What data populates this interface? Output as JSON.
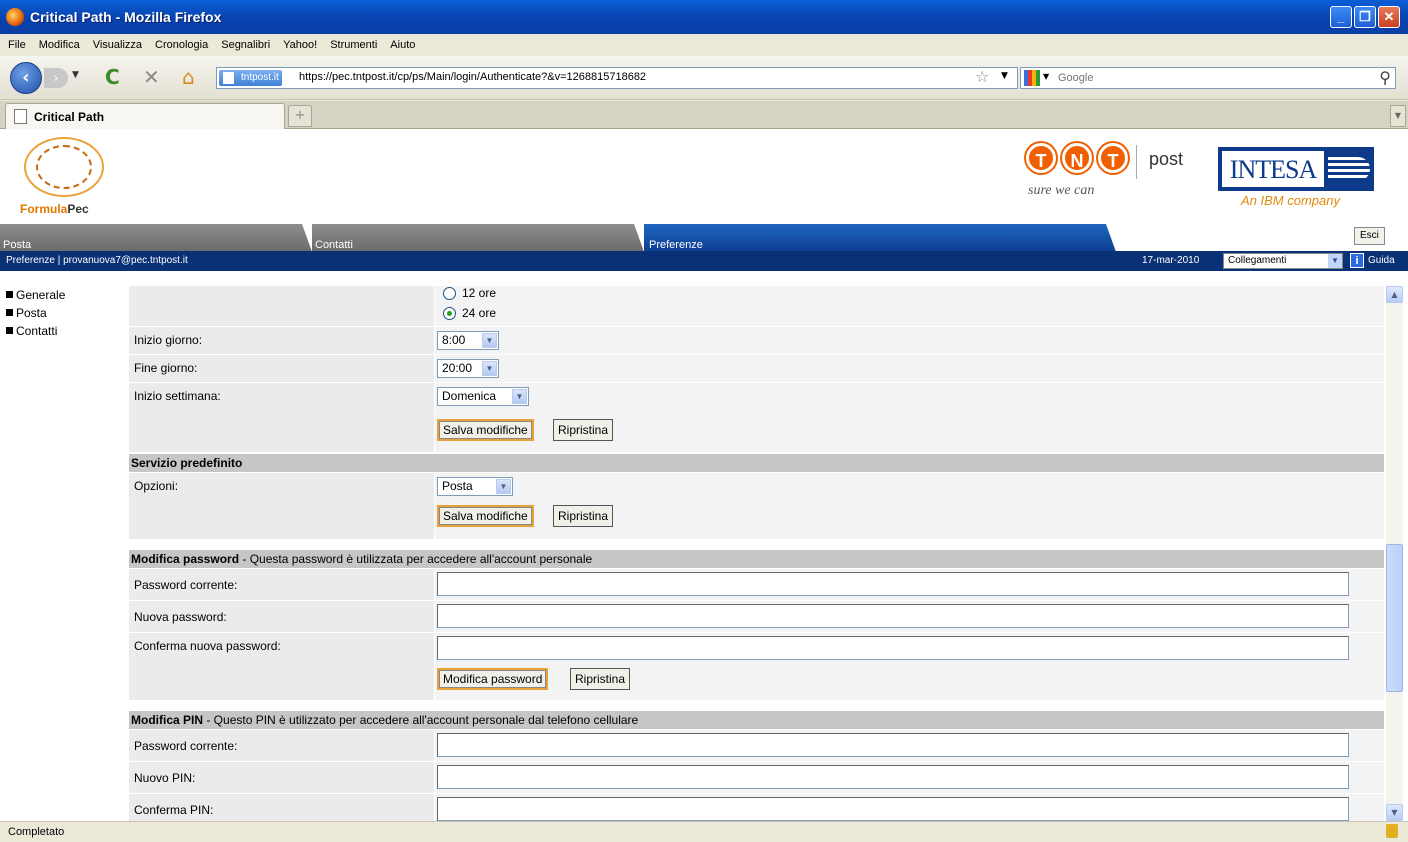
{
  "window": {
    "title": "Critical Path - Mozilla Firefox"
  },
  "menu": [
    "File",
    "Modifica",
    "Visualizza",
    "Cronologia",
    "Segnalibri",
    "Yahoo!",
    "Strumenti",
    "Aiuto"
  ],
  "nav": {
    "site_identity": "tntpost.it",
    "url": "https://pec.tntpost.it/cp/ps/Main/login/Authenticate?&v=1268815718682",
    "search_placeholder": "Google"
  },
  "browser_tab": {
    "label": "Critical Path",
    "new_tab": "+"
  },
  "header": {
    "formula": "Formula",
    "pec": "Pec",
    "tnt_letters": [
      "T",
      "N",
      "T"
    ],
    "tnt_post": "post",
    "tnt_slogan": "sure we can",
    "intesa": "INTESA",
    "ibm": "An IBM company"
  },
  "app_tabs": [
    {
      "label": "Posta",
      "active": false
    },
    {
      "label": "Contatti",
      "active": false
    },
    {
      "label": "Preferenze",
      "active": true
    }
  ],
  "esci": "Esci",
  "bluebar": {
    "breadcrumb": "Preferenze  |  provanuova7@pec.tntpost.it",
    "date": "17-mar-2010",
    "collegamenti": "Collegamenti",
    "guida": "Guida"
  },
  "leftnav": [
    "Generale",
    "Posta",
    "Contatti"
  ],
  "form": {
    "time_format": {
      "opt12": "12 ore",
      "opt24": "24 ore",
      "selected": "24 ore"
    },
    "inizio_giorno": {
      "label": "Inizio giorno:",
      "value": "8:00"
    },
    "fine_giorno": {
      "label": "Fine giorno:",
      "value": "20:00"
    },
    "inizio_settimana": {
      "label": "Inizio settimana:",
      "value": "Domenica"
    },
    "save": "Salva modifiche",
    "reset": "Ripristina",
    "servizio": {
      "title": "Servizio predefinito",
      "label": "Opzioni:",
      "value": "Posta"
    },
    "password": {
      "title": "Modifica password",
      "desc": " - Questa password è utilizzata per accedere all'account personale",
      "current": "Password corrente:",
      "new": "Nuova password:",
      "confirm": "Conferma nuova password:",
      "submit": "Modifica password"
    },
    "pin": {
      "title": "Modifica PIN",
      "desc": " - Questo PIN è utilizzato per accedere all'account personale dal telefono cellulare",
      "current": "Password corrente:",
      "new": "Nuovo PIN:",
      "confirm": "Conferma PIN:"
    }
  },
  "status": {
    "text": "Completato"
  }
}
